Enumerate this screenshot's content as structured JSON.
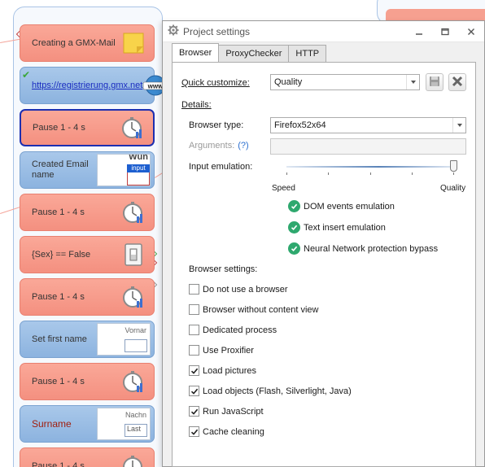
{
  "workflow": {
    "nodes": [
      {
        "label": "Creating a GMX-Mail",
        "color": "red",
        "icon": "sticky-note-icon"
      },
      {
        "label": "https://registrierung.gmx.net",
        "color": "blue",
        "icon": "www-globe-icon",
        "checked": true
      },
      {
        "label": "Pause 1 - 4 s",
        "color": "red",
        "icon": "stopwatch-icon",
        "selected": true
      },
      {
        "label": "Created Email name",
        "color": "blue",
        "thumb": {
          "header": "Wün",
          "badge": "input"
        }
      },
      {
        "label": "Pause 1 - 4 s",
        "color": "red",
        "icon": "stopwatch-icon"
      },
      {
        "label": "{Sex} == False",
        "color": "red",
        "icon": "switch-icon"
      },
      {
        "label": "Pause 1 - 4 s",
        "color": "red",
        "icon": "stopwatch-icon"
      },
      {
        "label": "Set first name",
        "color": "blue",
        "thumb": {
          "header": "Vornar"
        }
      },
      {
        "label": "Pause 1 - 4 s",
        "color": "red",
        "icon": "stopwatch-icon"
      },
      {
        "label": "Surname",
        "color": "blue",
        "thumb": {
          "header": "Nachn",
          "field": "Last"
        }
      },
      {
        "label": "Pause 1 - 4 s",
        "color": "red",
        "icon": "stopwatch-icon"
      }
    ]
  },
  "dialog": {
    "title": "Project settings",
    "window_buttons": [
      "minimize",
      "maximize",
      "close"
    ],
    "tabs": [
      {
        "label": "Browser",
        "active": true
      },
      {
        "label": "ProxyChecker",
        "active": false
      },
      {
        "label": "HTTP",
        "active": false
      }
    ],
    "quick_customize": {
      "label": "Quick customize:",
      "value": "Quality"
    },
    "details_label": "Details:",
    "browser_type": {
      "label": "Browser type:",
      "value": "Firefox52x64"
    },
    "arguments": {
      "label": "Arguments:",
      "help": "(?)",
      "value": ""
    },
    "input_emulation": {
      "label": "Input emulation:",
      "min_label": "Speed",
      "max_label": "Quality",
      "level": 1.0,
      "ticks": 5
    },
    "emulation_checks": [
      {
        "label": "DOM events emulation",
        "checked": true
      },
      {
        "label": "Text insert emulation",
        "checked": true
      },
      {
        "label": "Neural Network protection bypass",
        "checked": true
      }
    ],
    "browser_settings_label": "Browser settings:",
    "browser_settings": [
      {
        "label": "Do not use a browser",
        "checked": false
      },
      {
        "label": "Browser without content view",
        "checked": false
      },
      {
        "label": "Dedicated process",
        "checked": false
      },
      {
        "label": "Use Proxifier",
        "checked": false
      },
      {
        "label": "Load pictures",
        "checked": true
      },
      {
        "label": "Load objects (Flash, Silverlight, Java)",
        "checked": true
      },
      {
        "label": "Run JavaScript",
        "checked": true
      },
      {
        "label": "Cache cleaning",
        "checked": true
      }
    ]
  },
  "colors": {
    "node_red": "#f49080",
    "node_blue": "#8cb3df",
    "selected_border": "#1d2fb0",
    "check_green": "#2ea86e",
    "link_blue": "#2b6fd0"
  }
}
